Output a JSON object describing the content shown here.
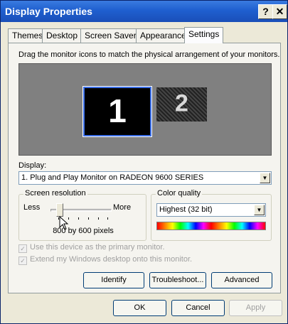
{
  "window": {
    "title": "Display Properties"
  },
  "titlebar": {
    "help": "?",
    "close": "✕"
  },
  "tabs": [
    {
      "label": "Themes"
    },
    {
      "label": "Desktop"
    },
    {
      "label": "Screen Saver"
    },
    {
      "label": "Appearance"
    },
    {
      "label": "Settings",
      "active": true
    }
  ],
  "settings": {
    "instruction": "Drag the monitor icons to match the physical arrangement of your monitors.",
    "monitors": [
      {
        "number": "1"
      },
      {
        "number": "2"
      }
    ],
    "display_label": "Display:",
    "display_value": "1. Plug and Play Monitor on RADEON 9600 SERIES",
    "resolution": {
      "label": "Screen resolution",
      "less": "Less",
      "more": "More",
      "value": "800 by 600 pixels",
      "slider_position": 0.1
    },
    "color_quality": {
      "label": "Color quality",
      "value": "Highest (32 bit)"
    },
    "checkboxes": {
      "primary": "Use this device as the primary monitor.",
      "extend": "Extend my Windows desktop onto this monitor."
    },
    "buttons": {
      "identify": "Identify",
      "troubleshoot": "Troubleshoot...",
      "advanced": "Advanced"
    }
  },
  "dialog_buttons": {
    "ok": "OK",
    "cancel": "Cancel",
    "apply": "Apply"
  },
  "colors": {
    "title_bar": "#1f5fcf",
    "selected_monitor_border": "#3a6ee8",
    "preview_background": "#808080"
  }
}
